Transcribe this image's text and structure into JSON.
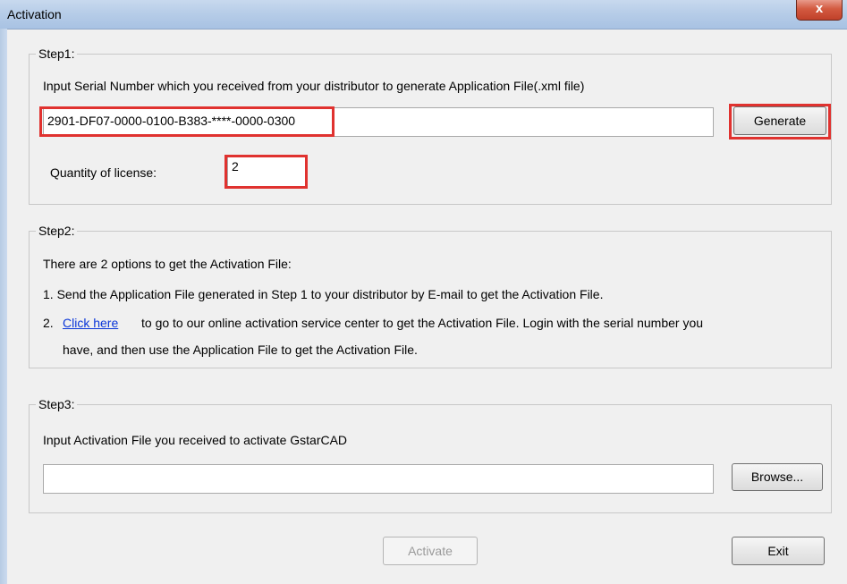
{
  "window": {
    "title": "Activation",
    "close_glyph": "x"
  },
  "step1": {
    "legend": "Step1:",
    "instruction": "Input Serial Number which you received from your distributor to generate Application File(.xml file)",
    "serial_value": "2901-DF07-0000-0100-B383-****-0000-0300",
    "generate_label": "Generate",
    "quantity_label": "Quantity of license:",
    "quantity_value": "2"
  },
  "step2": {
    "legend": "Step2:",
    "intro": "There are 2 options to get the Activation File:",
    "option1": "1.  Send the Application File generated in Step 1 to your distributor by E-mail to get the Activation File.",
    "option2_num": "2.",
    "option2_link": "Click here",
    "option2_text": "to go to our online activation service center to get the Activation File. Login with the serial number you",
    "option2_cont": "have, and then use the Application File to get the Activation File."
  },
  "step3": {
    "legend": "Step3:",
    "instruction": "Input Activation File you received to activate GstarCAD",
    "file_value": "",
    "browse_label": "Browse..."
  },
  "footer": {
    "activate_label": "Activate",
    "exit_label": "Exit"
  },
  "colors": {
    "highlight": "#e0322f",
    "link": "#0a36d8",
    "titlebar": "#b7cde8"
  },
  "icons": {
    "close": "close-icon"
  }
}
